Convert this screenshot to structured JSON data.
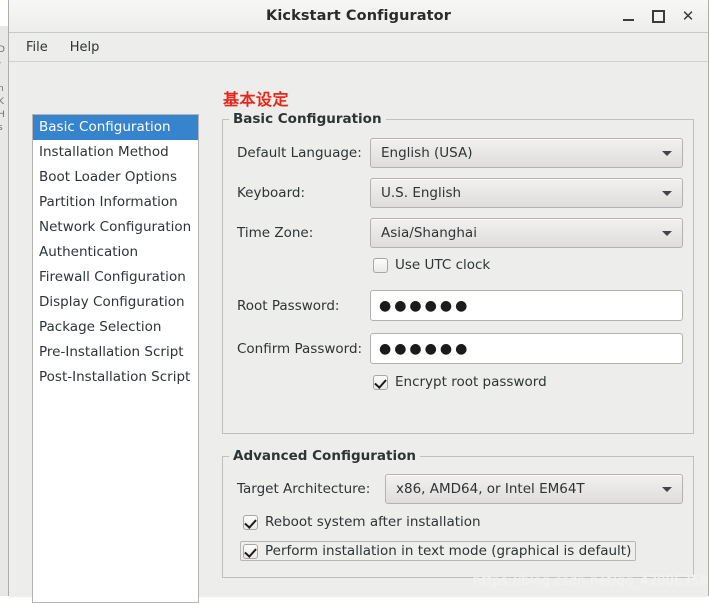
{
  "window": {
    "title": "Kickstart Configurator",
    "minimize_label": "–",
    "maximize_label": "□",
    "close_label": "✕"
  },
  "menubar": {
    "items": [
      {
        "label": "File"
      },
      {
        "label": "Help"
      }
    ]
  },
  "sidebar": {
    "items": [
      {
        "label": "Basic Configuration",
        "selected": true
      },
      {
        "label": "Installation Method",
        "selected": false
      },
      {
        "label": "Boot Loader Options",
        "selected": false
      },
      {
        "label": "Partition Information",
        "selected": false
      },
      {
        "label": "Network Configuration",
        "selected": false
      },
      {
        "label": "Authentication",
        "selected": false
      },
      {
        "label": "Firewall Configuration",
        "selected": false
      },
      {
        "label": "Display Configuration",
        "selected": false
      },
      {
        "label": "Package Selection",
        "selected": false
      },
      {
        "label": "Pre-Installation Script",
        "selected": false
      },
      {
        "label": "Post-Installation Script",
        "selected": false
      }
    ]
  },
  "annotation": {
    "cjk_heading": "基本设定",
    "cjk_heading_color": "#e8271b"
  },
  "basic_configuration": {
    "group_title": "Basic Configuration",
    "default_language": {
      "label": "Default Language:",
      "value": "English (USA)"
    },
    "keyboard": {
      "label": "Keyboard:",
      "value": "U.S. English"
    },
    "time_zone": {
      "label": "Time Zone:",
      "value": "Asia/Shanghai"
    },
    "use_utc_clock": {
      "label": "Use UTC clock",
      "checked": false
    },
    "root_password": {
      "label": "Root Password:",
      "value": "●●●●●●",
      "placeholder": ""
    },
    "confirm_password": {
      "label": "Confirm Password:",
      "value": "●●●●●●",
      "placeholder": ""
    },
    "encrypt_root_password": {
      "label": "Encrypt root password",
      "checked": true
    }
  },
  "advanced_configuration": {
    "group_title": "Advanced Configuration",
    "target_architecture": {
      "label": "Target Architecture:",
      "value": "x86, AMD64, or Intel EM64T"
    },
    "reboot_after_install": {
      "label": "Reboot system after installation",
      "checked": true
    },
    "text_mode_install": {
      "label": "Perform installation in text mode (graphical is default)",
      "checked": true,
      "focused": true
    }
  },
  "watermark": {
    "text": "https://blog.csdn.net/qq_42006358"
  },
  "background_window": {
    "edge_text": "D\n-\n.\nn\nK\nH\ns"
  },
  "colors": {
    "selection": "#3584cd",
    "window_bg": "#ededec",
    "list_bg": "#ffffff",
    "accent_red": "#e8271b"
  }
}
